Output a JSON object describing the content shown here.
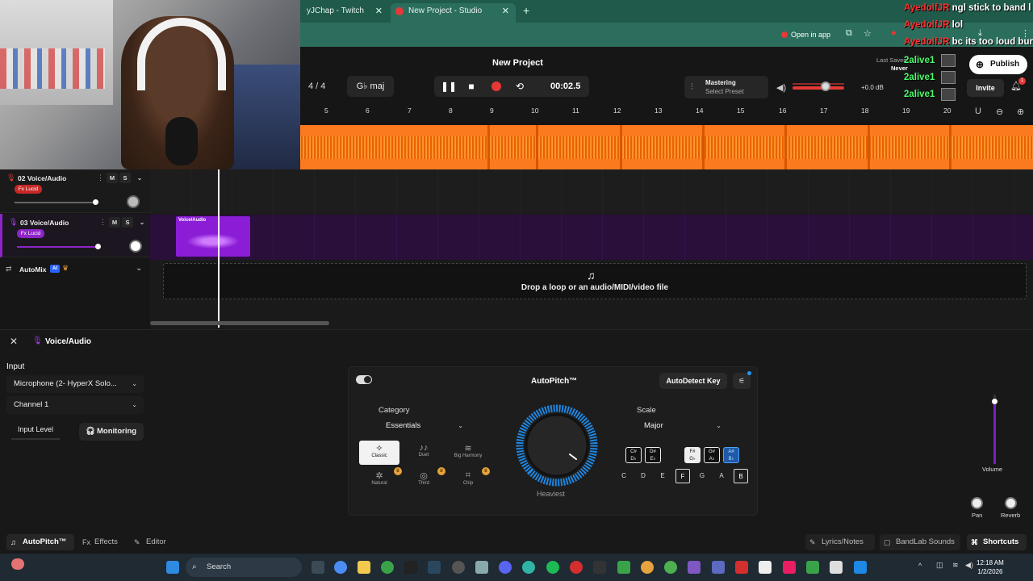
{
  "browser": {
    "tabs": [
      {
        "label": "yJChap - Twitch"
      },
      {
        "label": "New Project - Studio"
      }
    ],
    "new_tab": "+",
    "open_in_app": "Open in app"
  },
  "chat": [
    {
      "name": "AyedolfJR",
      "message": "ngl stick to band l",
      "color": "red"
    },
    {
      "name": "AyedolfJR",
      "message": "lol",
      "color": "red"
    },
    {
      "name": "AyedolfJR",
      "message": "bc its too loud bur",
      "color": "red"
    },
    {
      "name": "2alive1",
      "message": "",
      "color": "green"
    },
    {
      "name": "2alive1",
      "message": "",
      "color": "green"
    },
    {
      "name": "2alive1",
      "message": "",
      "color": "green"
    }
  ],
  "studio": {
    "project_title": "New Project",
    "time_signature": "4 / 4",
    "key": "G♭ maj",
    "timecode": "00:02.5",
    "mastering_title": "Mastering",
    "mastering_sub": "Select Preset",
    "volume_db": "+0.0 dB",
    "last_saved": "Last Saved:",
    "never": "Never",
    "publish": "Publish",
    "invite": "Invite",
    "notification_count": "1"
  },
  "ruler": [
    "5",
    "6",
    "7",
    "8",
    "9",
    "10",
    "11",
    "12",
    "13",
    "14",
    "15",
    "16",
    "17",
    "18",
    "19",
    "20"
  ],
  "tracks": [
    {
      "name": "02  Voice/Audio",
      "fx": "Fx Lucid",
      "m": "M",
      "s": "S",
      "fx_color": "#c62828"
    },
    {
      "name": "03  Voice/Audio",
      "fx": "Fx Lucid",
      "m": "M",
      "s": "S",
      "fx_color": "#8e24c8"
    }
  ],
  "clip_label": "Voice/Audio",
  "automix": {
    "label": "AutoMix",
    "ai": "AI"
  },
  "dropzone": "Drop a loop or an audio/MIDI/video file",
  "panel": {
    "title": "Voice/Audio",
    "input_label": "Input",
    "mic_select": "Microphone (2- HyperX Solo...",
    "channel_select": "Channel 1",
    "input_level": "Input Level",
    "monitoring": "Monitoring",
    "autopitch": {
      "title": "AutoPitch™",
      "autodetect": "AutoDetect Key",
      "category_label": "Category",
      "category_value": "Essentials",
      "presets": [
        {
          "label": "Classic",
          "icon": "✧"
        },
        {
          "label": "Duet",
          "icon": "♪♪"
        },
        {
          "label": "Big Harmony",
          "icon": "≋"
        },
        {
          "label": "Natural",
          "icon": "✲"
        },
        {
          "label": "Third",
          "icon": "◎"
        },
        {
          "label": "Chip",
          "icon": "⌗"
        }
      ],
      "knob_label": "Heaviest",
      "scale_label": "Scale",
      "scale_value": "Major",
      "sharp_keys": [
        {
          "top": "C#",
          "bot": "D♭"
        },
        {
          "top": "D#",
          "bot": "E♭"
        },
        {
          "top": "F#",
          "bot": "G♭"
        },
        {
          "top": "G#",
          "bot": "A♭"
        },
        {
          "top": "A#",
          "bot": "B♭"
        }
      ],
      "natural_keys": [
        "C",
        "D",
        "E",
        "F",
        "G",
        "A",
        "B"
      ]
    },
    "volume_label": "Volume",
    "pan_label": "Pan",
    "reverb_label": "Reverb"
  },
  "footer": {
    "autopitch": "AutoPitch™",
    "effects": "Effects",
    "editor": "Editor",
    "lyrics": "Lyrics/Notes",
    "sounds": "BandLab Sounds",
    "shortcuts": "Shortcuts"
  },
  "taskbar": {
    "search": "Search",
    "time": "12:18 AM",
    "date": "1/2/2026"
  },
  "colors": {
    "accent_purple": "#8e24c8",
    "waveform_orange": "#fc7a1e",
    "record_red": "#e53935",
    "browser_green": "#2c6e5d"
  }
}
